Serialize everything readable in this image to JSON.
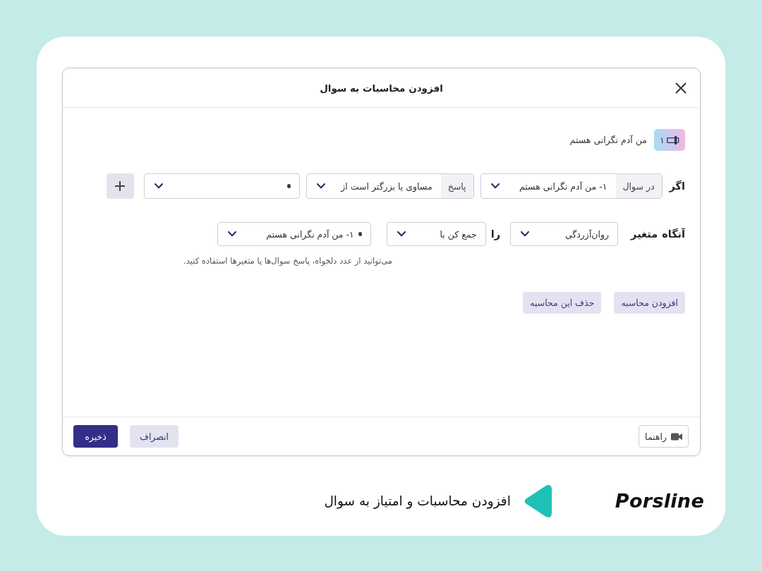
{
  "dialog": {
    "title": "افزودن محاسبات به سوال",
    "question": {
      "number": "۱",
      "text": "من آدم نگرانی هستم"
    },
    "condition": {
      "label": "اگر",
      "fields": [
        {
          "kind": "select",
          "prefix": "در سوال",
          "value": "۱- من آدم نگرانی هستم"
        },
        {
          "kind": "select",
          "prefix": "پاسخ",
          "value": "مساوی یا بزرگتر است از"
        },
        {
          "kind": "operand"
        }
      ]
    },
    "action": {
      "labels": [
        "آنگاه",
        "متغیر"
      ],
      "variable": {
        "kind": "select",
        "value": "روان‌آزردگی"
      },
      "connector": "را",
      "operation": {
        "kind": "select",
        "value": "جمع کن با"
      },
      "operand": {
        "kind": "operand",
        "value": "۱- من آدم نگرانی هستم"
      },
      "hint": "می‌توانید از عدد دلخواه، پاسخ سوال‌ها یا متغیرها استفاده کنید."
    },
    "calculation_buttons": [
      "افزودن محاسبه",
      "حذف این محاسبه"
    ],
    "footer_buttons": [
      {
        "kind": "help",
        "label": "راهنما"
      },
      {
        "kind": "secondary",
        "label": "انصراف"
      },
      {
        "kind": "primary",
        "label": "ذخیره"
      }
    ]
  },
  "banner": {
    "logo": "Porsline",
    "caption": "افزودن محاسبات و امتیاز به سوال"
  }
}
